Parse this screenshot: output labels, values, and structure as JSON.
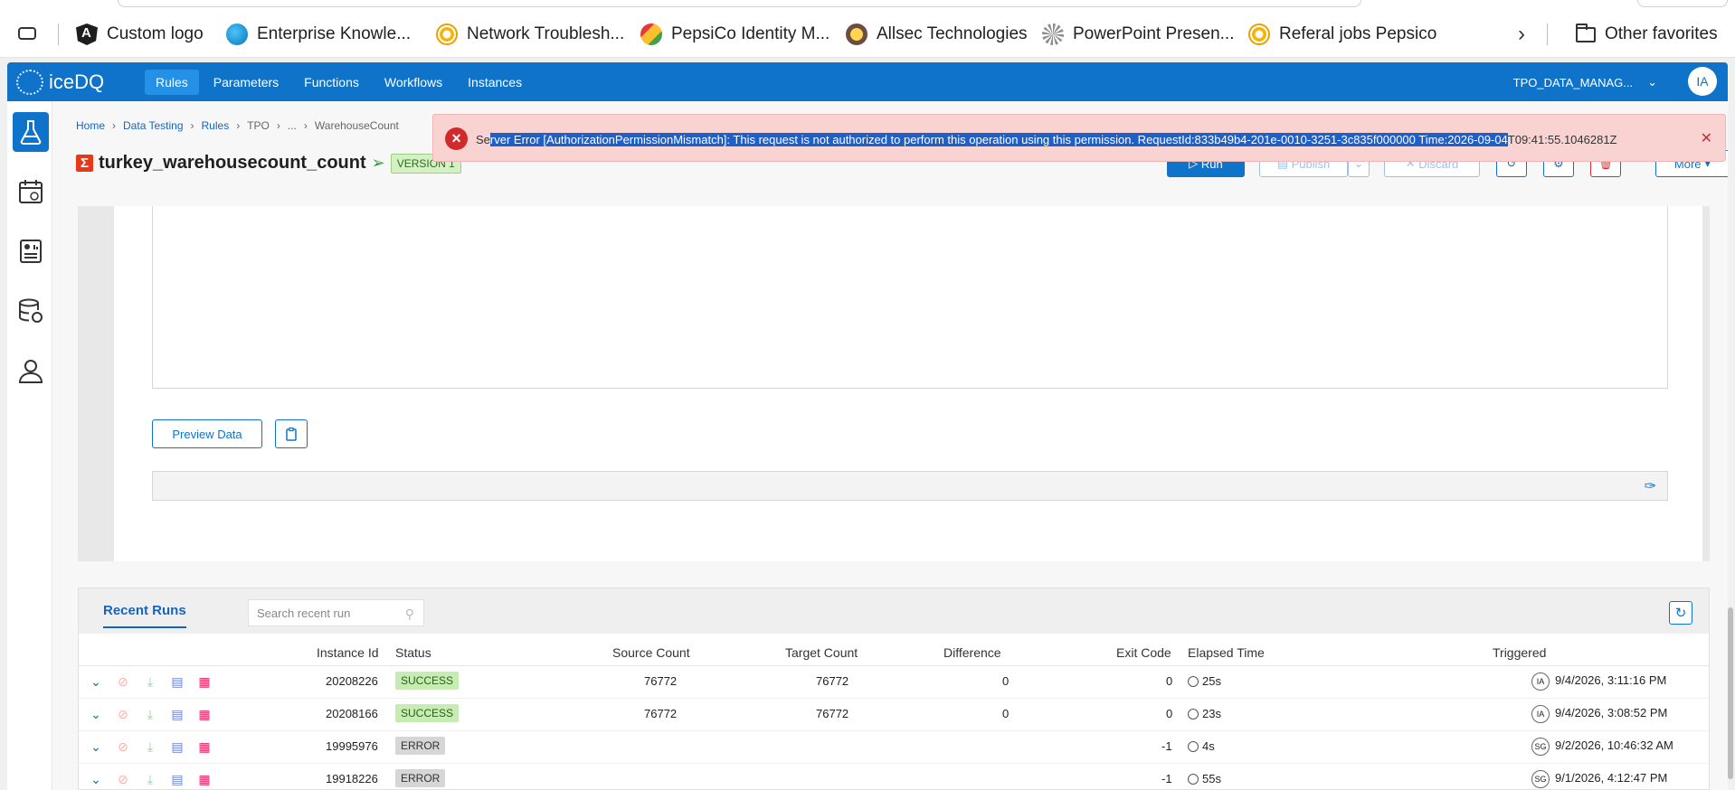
{
  "favorites": [
    {
      "label": "Custom logo",
      "icon": "angular-icon"
    },
    {
      "label": "Enterprise Knowle...",
      "icon": "enterprise-icon"
    },
    {
      "label": "Network Troublesh...",
      "icon": "pepsico-icon"
    },
    {
      "label": "PepsiCo Identity M...",
      "icon": "pepsico-identity-icon"
    },
    {
      "label": "Allsec Technologies",
      "icon": "allsec-icon"
    },
    {
      "label": "PowerPoint Presen...",
      "icon": "powerpoint-icon"
    },
    {
      "label": "Referal jobs Pepsico",
      "icon": "pepsico-icon"
    }
  ],
  "other_favorites": "Other favorites",
  "app": {
    "brand": "iceDQ",
    "nav": [
      "Rules",
      "Parameters",
      "Functions",
      "Workflows",
      "Instances"
    ],
    "tenant": "TPO_DATA_MANAG...",
    "user_initials": "IA"
  },
  "breadcrumb": [
    "Home",
    "Data Testing",
    "Rules",
    "TPO",
    "...",
    "WarehouseCount"
  ],
  "rule": {
    "title": "turkey_warehousecount_count",
    "version": "VERSION 1"
  },
  "toolbar": {
    "run": "Run",
    "publish": "Publish",
    "discard": "Discard",
    "more": "More"
  },
  "editor": {
    "preview": "Preview Data"
  },
  "toast": {
    "pre": "Se",
    "selected": "rver Error [AuthorizationPermissionMismatch]: This request is not authorized to perform this operation using this permission. RequestId:833b49b4-201e-0010-3251-3c835f000000 Time:2026-09-04",
    "post": "T09:41:55.1046281Z"
  },
  "recent_runs": {
    "tab": "Recent Runs",
    "search_placeholder": "Search recent run",
    "columns": [
      "Instance Id",
      "Status",
      "Source Count",
      "Target Count",
      "Difference",
      "Exit Code",
      "Elapsed Time",
      "Triggered"
    ],
    "rows": [
      {
        "id": "20208226",
        "status": "SUCCESS",
        "source": "76772",
        "target": "76772",
        "diff": "0",
        "exit": "0",
        "elapsed": "25s",
        "user": "IA",
        "triggered": "9/4/2026, 3:11:16 PM"
      },
      {
        "id": "20208166",
        "status": "SUCCESS",
        "source": "76772",
        "target": "76772",
        "diff": "0",
        "exit": "0",
        "elapsed": "23s",
        "user": "IA",
        "triggered": "9/4/2026, 3:08:52 PM"
      },
      {
        "id": "19995976",
        "status": "ERROR",
        "source": "",
        "target": "",
        "diff": "",
        "exit": "-1",
        "elapsed": "4s",
        "user": "SG",
        "triggered": "9/2/2026, 10:46:32 AM"
      },
      {
        "id": "19918226",
        "status": "ERROR",
        "source": "",
        "target": "",
        "diff": "",
        "exit": "-1",
        "elapsed": "55s",
        "user": "SG",
        "triggered": "9/1/2026, 4:12:47 PM"
      }
    ]
  }
}
